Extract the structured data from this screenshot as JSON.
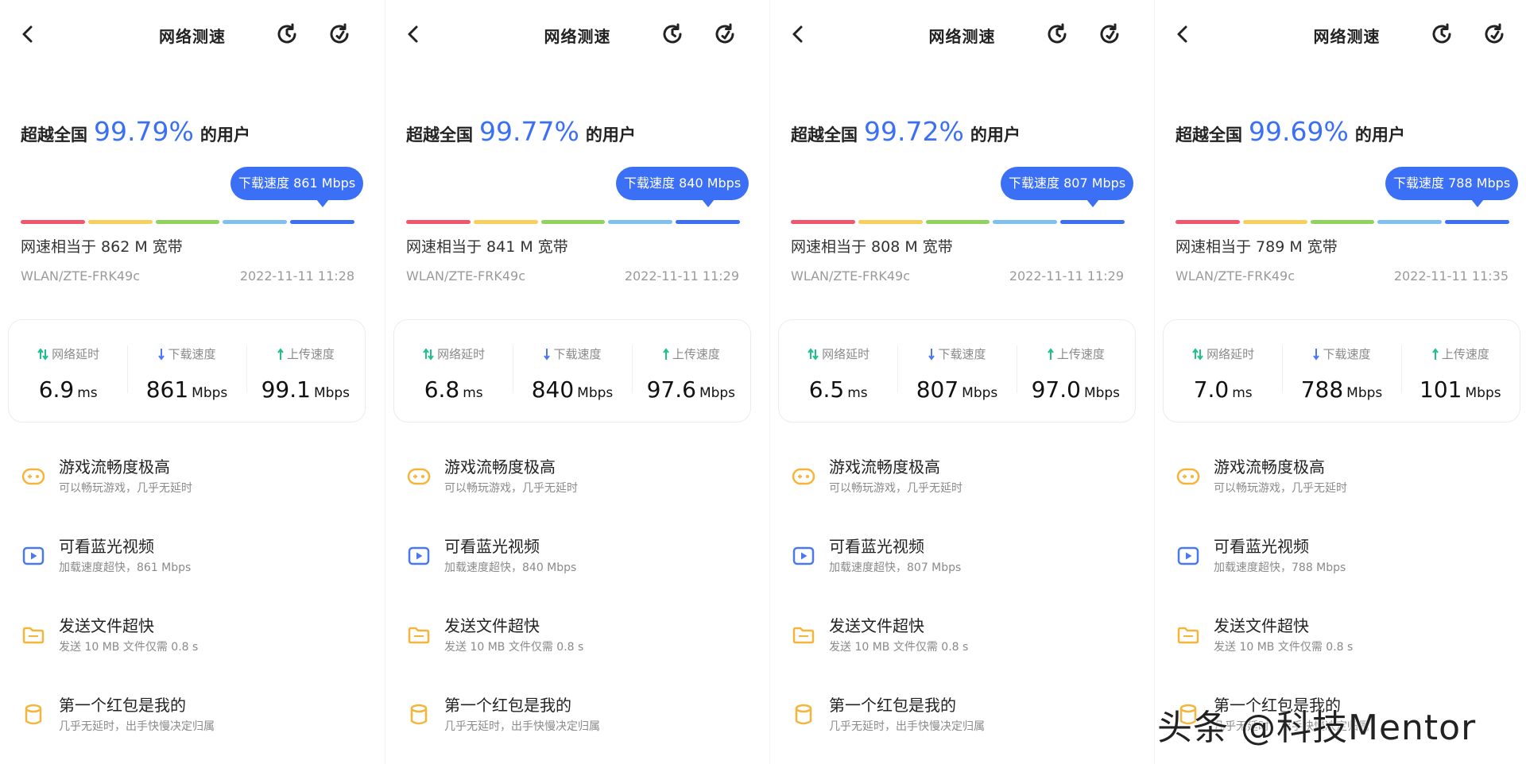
{
  "colors": {
    "accent": "#3b6ff5",
    "bar_segments": [
      "#f0566c",
      "#f8cf5b",
      "#8fd35e",
      "#7fc0f3",
      "#3b6ff5"
    ],
    "latency_icon": "#1fbf8f",
    "download_icon": "#4a78f0",
    "upload_icon": "#1fbf8f",
    "game_icon": "#f5b53b",
    "video_icon": "#4a78f0",
    "file_icon": "#f5b53b",
    "redpacket_icon": "#f5b53b"
  },
  "icons": {
    "back": "chevron-left-icon",
    "history": "history-icon",
    "retest": "refresh-icon",
    "latency": "up-down-arrows-icon",
    "download": "down-arrow-icon",
    "upload": "up-arrow-icon",
    "game": "gamepad-icon",
    "video": "play-icon",
    "file": "folder-icon",
    "redpacket": "cylinder-icon"
  },
  "panels": [
    {
      "title": "网络测速",
      "rank_prefix": "超越全国",
      "rank_percent": "99.79%",
      "rank_suffix": "的用户",
      "bubble": "下载速度 861 Mbps",
      "bandwidth": "网速相当于 862 M 宽带",
      "network": "WLAN/ZTE-FRK49c",
      "time": "2022-11-11 11:28",
      "stats": [
        {
          "label": "网络延时",
          "value": "6.9",
          "unit": "ms"
        },
        {
          "label": "下载速度",
          "value": "861",
          "unit": "Mbps"
        },
        {
          "label": "上传速度",
          "value": "99.1",
          "unit": "Mbps"
        }
      ],
      "features": [
        {
          "title": "游戏流畅度极高",
          "sub": "可以畅玩游戏，几乎无延时"
        },
        {
          "title": "可看蓝光视频",
          "sub": "加载速度超快，861 Mbps"
        },
        {
          "title": "发送文件超快",
          "sub": "发送 10 MB 文件仅需 0.8 s"
        },
        {
          "title": "第一个红包是我的",
          "sub": "几乎无延时，出手快慢决定归属"
        }
      ]
    },
    {
      "title": "网络测速",
      "rank_prefix": "超越全国",
      "rank_percent": "99.77%",
      "rank_suffix": "的用户",
      "bubble": "下载速度 840 Mbps",
      "bandwidth": "网速相当于 841 M 宽带",
      "network": "WLAN/ZTE-FRK49c",
      "time": "2022-11-11 11:29",
      "stats": [
        {
          "label": "网络延时",
          "value": "6.8",
          "unit": "ms"
        },
        {
          "label": "下载速度",
          "value": "840",
          "unit": "Mbps"
        },
        {
          "label": "上传速度",
          "value": "97.6",
          "unit": "Mbps"
        }
      ],
      "features": [
        {
          "title": "游戏流畅度极高",
          "sub": "可以畅玩游戏，几乎无延时"
        },
        {
          "title": "可看蓝光视频",
          "sub": "加载速度超快，840 Mbps"
        },
        {
          "title": "发送文件超快",
          "sub": "发送 10 MB 文件仅需 0.8 s"
        },
        {
          "title": "第一个红包是我的",
          "sub": "几乎无延时，出手快慢决定归属"
        }
      ]
    },
    {
      "title": "网络测速",
      "rank_prefix": "超越全国",
      "rank_percent": "99.72%",
      "rank_suffix": "的用户",
      "bubble": "下载速度 807 Mbps",
      "bandwidth": "网速相当于 808 M 宽带",
      "network": "WLAN/ZTE-FRK49c",
      "time": "2022-11-11 11:29",
      "stats": [
        {
          "label": "网络延时",
          "value": "6.5",
          "unit": "ms"
        },
        {
          "label": "下载速度",
          "value": "807",
          "unit": "Mbps"
        },
        {
          "label": "上传速度",
          "value": "97.0",
          "unit": "Mbps"
        }
      ],
      "features": [
        {
          "title": "游戏流畅度极高",
          "sub": "可以畅玩游戏，几乎无延时"
        },
        {
          "title": "可看蓝光视频",
          "sub": "加载速度超快，807 Mbps"
        },
        {
          "title": "发送文件超快",
          "sub": "发送 10 MB 文件仅需 0.8 s"
        },
        {
          "title": "第一个红包是我的",
          "sub": "几乎无延时，出手快慢决定归属"
        }
      ]
    },
    {
      "title": "网络测速",
      "rank_prefix": "超越全国",
      "rank_percent": "99.69%",
      "rank_suffix": "的用户",
      "bubble": "下载速度 788 Mbps",
      "bandwidth": "网速相当于 789 M 宽带",
      "network": "WLAN/ZTE-FRK49c",
      "time": "2022-11-11 11:35",
      "stats": [
        {
          "label": "网络延时",
          "value": "7.0",
          "unit": "ms"
        },
        {
          "label": "下载速度",
          "value": "788",
          "unit": "Mbps"
        },
        {
          "label": "上传速度",
          "value": "101",
          "unit": "Mbps"
        }
      ],
      "features": [
        {
          "title": "游戏流畅度极高",
          "sub": "可以畅玩游戏，几乎无延时"
        },
        {
          "title": "可看蓝光视频",
          "sub": "加载速度超快，788 Mbps"
        },
        {
          "title": "发送文件超快",
          "sub": "发送 10 MB 文件仅需 0.8 s"
        },
        {
          "title": "第一个红包是我的",
          "sub": "几乎无延时，出手快慢决定归属"
        }
      ]
    }
  ],
  "watermark": "头条 @科技Mentor"
}
